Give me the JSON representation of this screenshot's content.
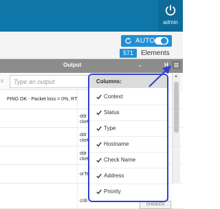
{
  "topbar": {
    "user_label": "admin"
  },
  "toolbar": {
    "auto_label": "AUTO",
    "elements_count": "571",
    "elements_label": "Elements"
  },
  "table": {
    "headers": {
      "left_partial": "",
      "output": "Output",
      "host_partial": "H"
    },
    "filter": {
      "left_partial": "s",
      "output_placeholder": "Type an output"
    },
    "rows": [
      {
        "output": "PING OK - Packet loss = 0%, RT",
        "host": [
          "",
          ""
        ]
      },
      {
        "output": "",
        "host": [
          "ddr",
          "cket"
        ]
      },
      {
        "output": "",
        "host": [
          "ddr",
          "cket"
        ]
      },
      {
        "output": "",
        "host": [
          "ddr",
          "cket"
        ]
      },
      {
        "output": "",
        "host": [
          "orTe",
          ""
        ]
      },
      {
        "output": "",
        "host": [
          "c/di",
          ""
        ]
      }
    ],
    "logo_text": "SHINKEN"
  },
  "columns_menu": {
    "title": "Columns:",
    "items": [
      {
        "label": "Context",
        "checked": true
      },
      {
        "label": "Status",
        "checked": true
      },
      {
        "label": "Type",
        "checked": true
      },
      {
        "label": "Hostname",
        "checked": true
      },
      {
        "label": "Check Name",
        "checked": true
      },
      {
        "label": "Address",
        "checked": true
      },
      {
        "label": "Priority",
        "checked": true
      }
    ]
  },
  "colors": {
    "topbar": "#0e76a8",
    "accent": "#1f8fd6",
    "table_header": "#8c8c8c",
    "highlight": "#2f3fd1"
  }
}
